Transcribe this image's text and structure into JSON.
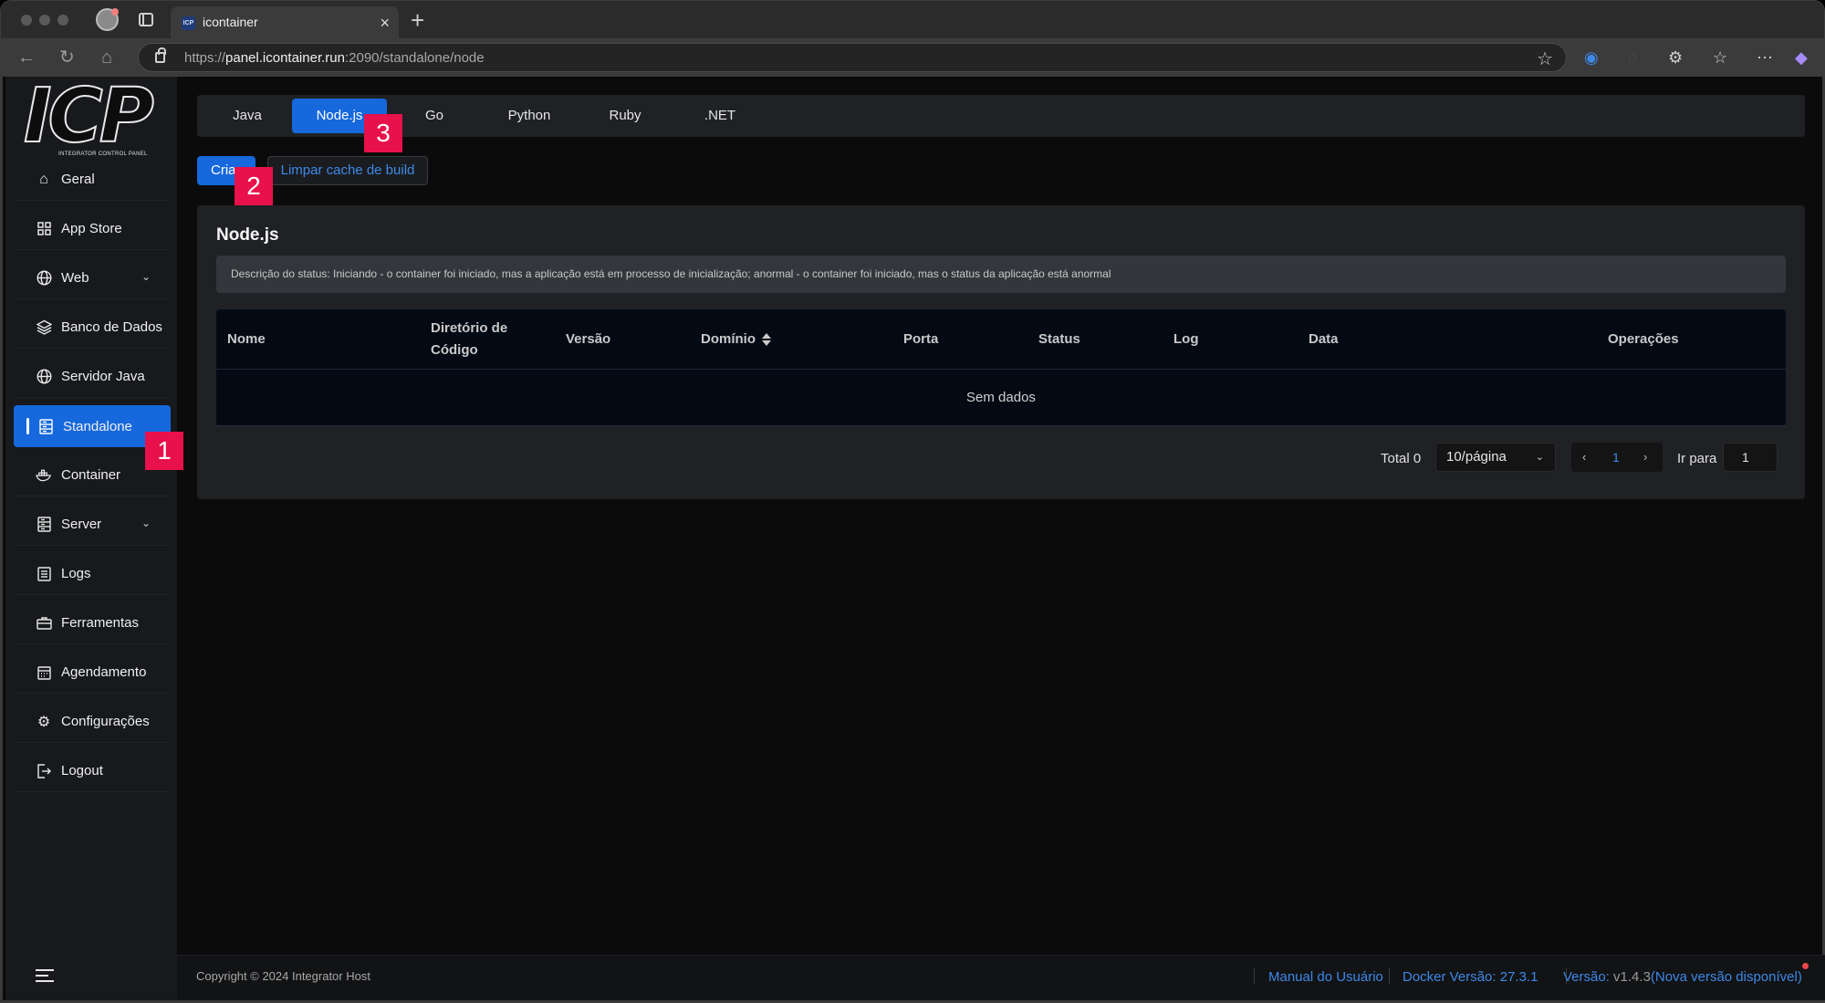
{
  "browser": {
    "tab_title": "icontainer",
    "tab_favicon_text": "ICP",
    "url_prefix": "https://",
    "url_host": "panel.icontainer.run",
    "url_path": ":2090/standalone/node"
  },
  "logo": {
    "text": "ICP",
    "subtitle": "INTEGRATOR CONTROL PANEL"
  },
  "sidebar": {
    "items": [
      {
        "label": "Geral",
        "icon": "home-icon"
      },
      {
        "label": "App Store",
        "icon": "grid-icon"
      },
      {
        "label": "Web",
        "icon": "globe-icon",
        "expandable": true
      },
      {
        "label": "Banco de Dados",
        "icon": "layers-icon"
      },
      {
        "label": "Servidor Java",
        "icon": "globe-icon"
      },
      {
        "label": "Standalone",
        "icon": "server-icon",
        "active": true
      },
      {
        "label": "Container",
        "icon": "docker-icon"
      },
      {
        "label": "Server",
        "icon": "server-icon",
        "expandable": true
      },
      {
        "label": "Logs",
        "icon": "list-icon"
      },
      {
        "label": "Ferramentas",
        "icon": "toolbox-icon"
      },
      {
        "label": "Agendamento",
        "icon": "calendar-icon"
      },
      {
        "label": "Configurações",
        "icon": "gear-icon"
      },
      {
        "label": "Logout",
        "icon": "logout-icon"
      }
    ]
  },
  "lang_tabs": {
    "items": [
      "Java",
      "Node.js",
      "Go",
      "Python",
      "Ruby",
      ".NET"
    ],
    "active": "Node.js"
  },
  "actions": {
    "create_label": "Criar",
    "clear_cache_label": "Limpar cache de build"
  },
  "badges": [
    "1",
    "2",
    "3"
  ],
  "card": {
    "title": "Node.js",
    "status_description": "Descrição do status: Iniciando - o container foi iniciado, mas a aplicação está em processo de inicialização; anormal - o container foi iniciado, mas o status da aplicação está anormal"
  },
  "table": {
    "columns": [
      "Nome",
      "Diretório de Código",
      "Versão",
      "Domínio",
      "Porta",
      "Status",
      "Log",
      "Data",
      "Operações"
    ],
    "empty_text": "Sem dados"
  },
  "pagination": {
    "total": "Total 0",
    "page_size": "10/página",
    "current_page": "1",
    "goto_label": "Ir para",
    "goto_value": "1"
  },
  "footer": {
    "copyright": "Copyright © 2024 Integrator Host",
    "manual": "Manual do Usuário",
    "docker_version": "Docker Versão: 27.3.1",
    "version_label": "Versão:",
    "version_value": "v1.4.3",
    "new_version": "(Nova versão disponível)"
  },
  "colors": {
    "accent": "#1668dc",
    "link": "#3c89e8",
    "badge": "#e8114b",
    "sidebar_bg": "#17191c",
    "card_bg": "#1f2124"
  }
}
